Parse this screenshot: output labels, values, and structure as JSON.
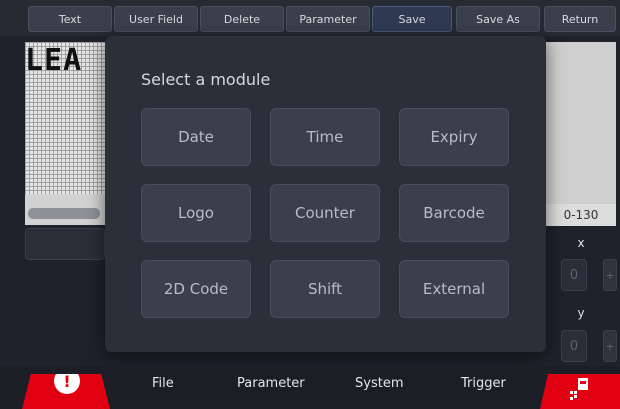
{
  "toolbar": {
    "buttons": [
      "Text",
      "User Field",
      "Delete",
      "Parameter",
      "Save",
      "Save As",
      "Return"
    ]
  },
  "editor": {
    "text": "LEA"
  },
  "right": {
    "range": "0-130",
    "x_label": "x",
    "x_value": "0",
    "y_label": "y",
    "y_value": "0",
    "plus": "+"
  },
  "dialog": {
    "title": "Select a module",
    "modules": [
      "Date",
      "Time",
      "Expiry",
      "Logo",
      "Counter",
      "Barcode",
      "2D Code",
      "Shift",
      "External"
    ]
  },
  "bottom_nav": {
    "items": [
      "File",
      "Parameter",
      "System",
      "Trigger"
    ]
  },
  "icons": {
    "alert": "warning-icon",
    "run": "printer-icon"
  },
  "colors": {
    "accent_red": "#e00012",
    "background": "#1f222b",
    "button": "#3a3f4c"
  }
}
